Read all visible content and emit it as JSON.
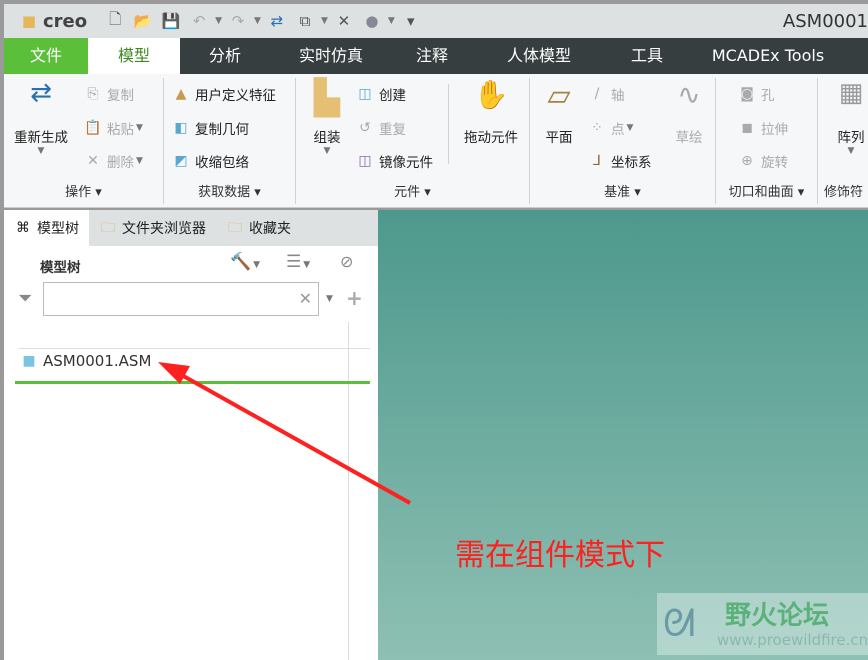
{
  "app": {
    "logo": "creo",
    "title": "ASM0001"
  },
  "quick_access": [
    "new-icon",
    "open-icon",
    "save-icon",
    "undo-icon",
    "redo-icon",
    "regenerate-icon",
    "windows-icon",
    "close-icon",
    "display-style-icon",
    "customize-icon"
  ],
  "tabs": [
    "文件",
    "模型",
    "分析",
    "实时仿真",
    "注释",
    "人体模型",
    "工具",
    "MCADEx Tools"
  ],
  "ribbon": {
    "ops": {
      "regen": "重新生成",
      "copy": "复制",
      "paste": "粘贴",
      "delete": "删除",
      "label": "操作"
    },
    "getdata": {
      "udf": "用户定义特征",
      "copygeom": "复制几何",
      "shrinkwrap": "收缩包络",
      "label": "获取数据"
    },
    "component": {
      "assemble": "组装",
      "create": "创建",
      "repeat": "重复",
      "mirror": "镜像元件",
      "drag": "拖动元件",
      "label": "元件"
    },
    "datum": {
      "plane": "平面",
      "axis": "轴",
      "point": "点",
      "csys": "坐标系",
      "sketch": "草绘",
      "label": "基准"
    },
    "cuts": {
      "hole": "孔",
      "extrude": "拉伸",
      "revolve": "旋转",
      "label": "切口和曲面"
    },
    "pattern": {
      "pattern": "阵列",
      "label": "修饰符"
    }
  },
  "panel": {
    "tabs": [
      "模型树",
      "文件夹浏览器",
      "收藏夹"
    ],
    "header": "模型树",
    "search_placeholder": "",
    "root": "ASM0001.ASM"
  },
  "annotation": {
    "text": "需在组件模式下",
    "color": "#ff2020"
  },
  "watermark": {
    "name": "野火论坛",
    "url": "www.proewildfire.cn"
  },
  "colors": {
    "file_tab": "#5cbf3a",
    "tabbar": "#363e40",
    "graphics_top": "#4d988c",
    "graphics_bottom": "#8ec0b3"
  }
}
